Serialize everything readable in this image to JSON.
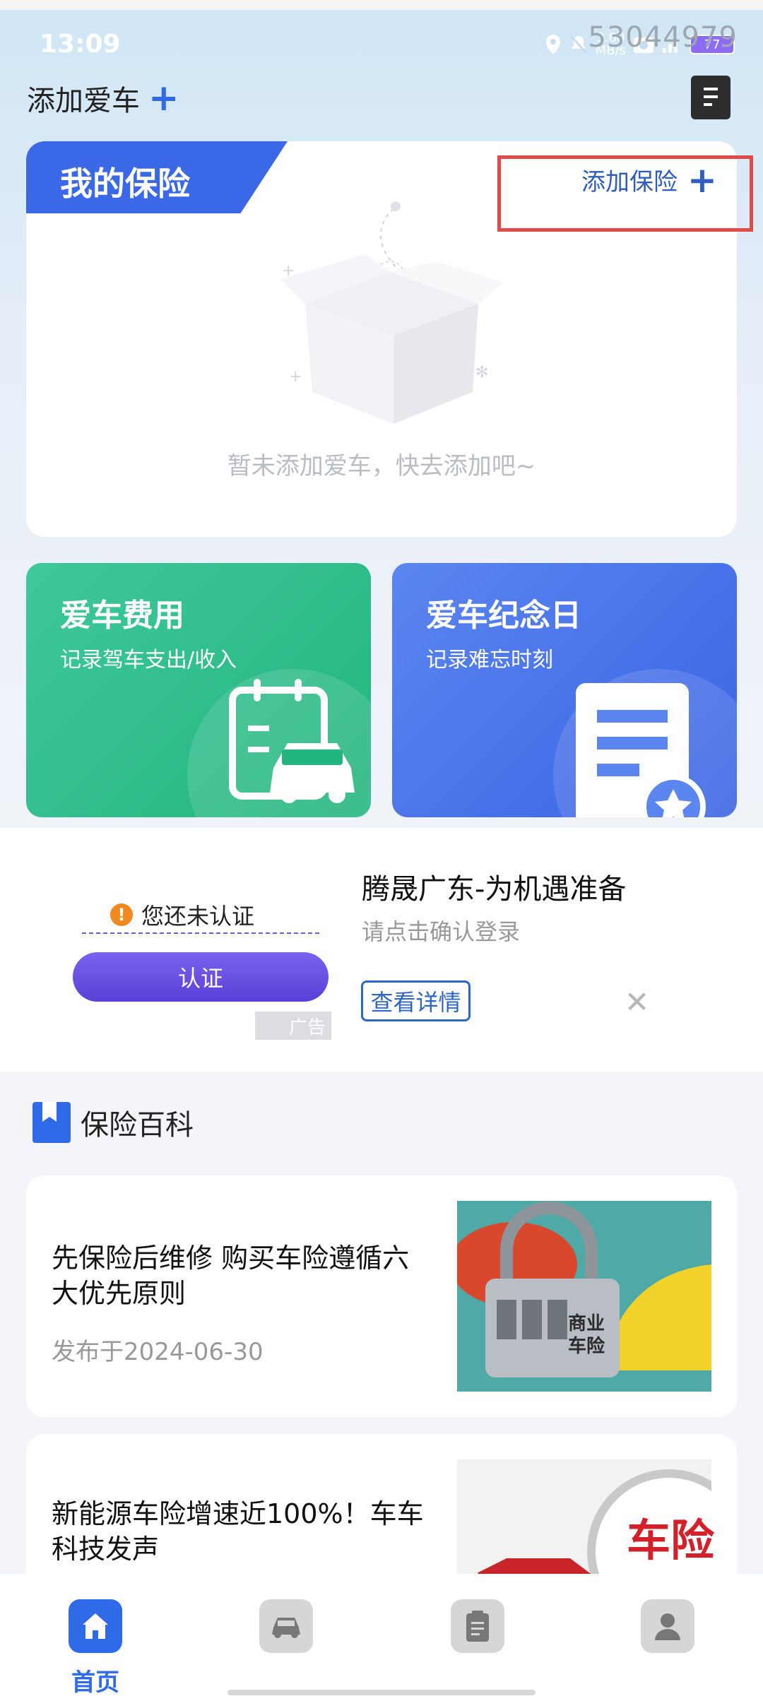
{
  "status_bar": {
    "time": "13:09",
    "net_speed": "3.00\nMB/s",
    "battery": "77",
    "overlay_number": "53044979"
  },
  "header": {
    "add_car_label": "添加爱车",
    "add_car_plus": "+"
  },
  "insurance_card": {
    "tab_title": "我的保险",
    "add_insurance_label": "添加保险",
    "add_insurance_plus": "+",
    "empty_text": "暂未添加爱车，快去添加吧~"
  },
  "tiles": [
    {
      "title": "爱车费用",
      "subtitle": "记录驾车支出/收入"
    },
    {
      "title": "爱车纪念日",
      "subtitle": "记录难忘时刻"
    }
  ],
  "ad": {
    "warning_text": "您还未认证",
    "certify_button": "认证",
    "ad_tag": "广告",
    "title": "腾晟广东-为机遇准备",
    "subtitle": "请点击确认登录",
    "detail_button": "查看详情",
    "close": "✕"
  },
  "wiki": {
    "title": "保险百科"
  },
  "articles": [
    {
      "title": "先保险后维修 购买车险遵循六大优先原则",
      "date": "发布于2024-06-30",
      "img_text": [
        "商业",
        "车险"
      ]
    },
    {
      "title": "新能源车险增速近100%！车车科技发声",
      "date": "",
      "img_text": [
        "车险"
      ]
    }
  ],
  "navbar": {
    "home_label": "首页"
  },
  "colors": {
    "accent": "#2f6ae8",
    "green_tile": "#22b57e",
    "blue_tile": "#3a63e3",
    "ad_purple": "#5a3fd6",
    "highlight_red": "#e24a4a"
  }
}
